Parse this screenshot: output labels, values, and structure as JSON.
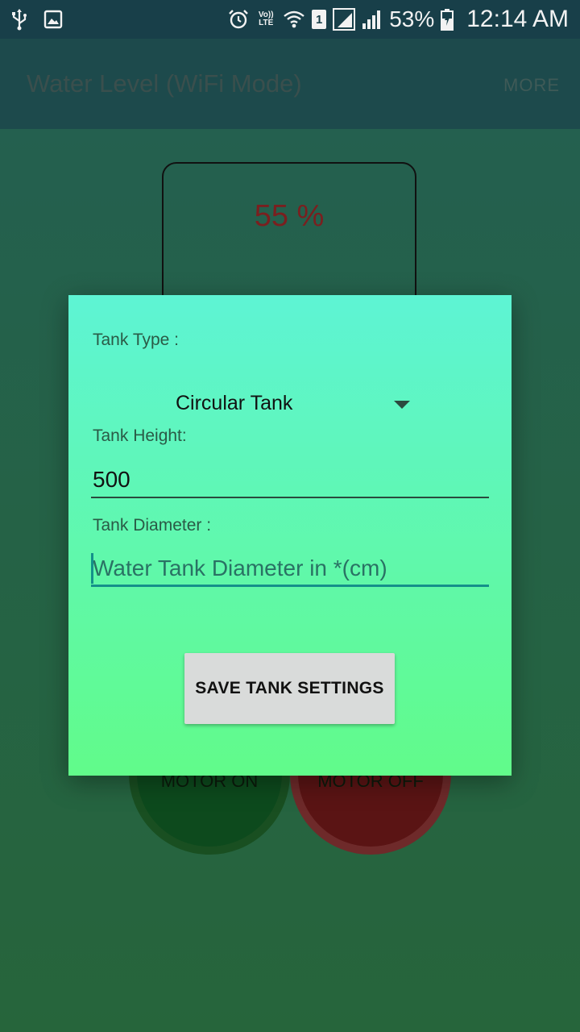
{
  "status_bar": {
    "icons_left": [
      "usb-icon",
      "image-icon"
    ],
    "icons_right": [
      "alarm-icon",
      "volte-icon",
      "wifi-icon",
      "sim-icon",
      "signal-r-icon",
      "signal-icon"
    ],
    "volte_top": "Vo))",
    "volte_bottom": "LTE",
    "sim_number": "1",
    "battery": "53%",
    "time": "12:14 AM"
  },
  "app_bar": {
    "title": "Water Level (WiFi Mode)",
    "more": "MORE"
  },
  "background": {
    "tank_percent": "55 %",
    "motor_on": "MOTOR ON",
    "motor_off": "MOTOR OFF"
  },
  "dialog": {
    "tank_type_label": "Tank Type :",
    "tank_type_value": "Circular Tank",
    "tank_height_label": "Tank Height:",
    "tank_height_value": "500",
    "tank_diameter_label": "Tank Diameter :",
    "tank_diameter_placeholder": "Water Tank Diameter in *(cm)",
    "save_button": "SAVE TANK SETTINGS"
  },
  "colors": {
    "status_bar": "#183f49",
    "app_bar": "#1d4a4c",
    "dialog_top": "#5ef4d4",
    "dialog_bottom": "#61fb8a",
    "accent": "#14908a"
  }
}
